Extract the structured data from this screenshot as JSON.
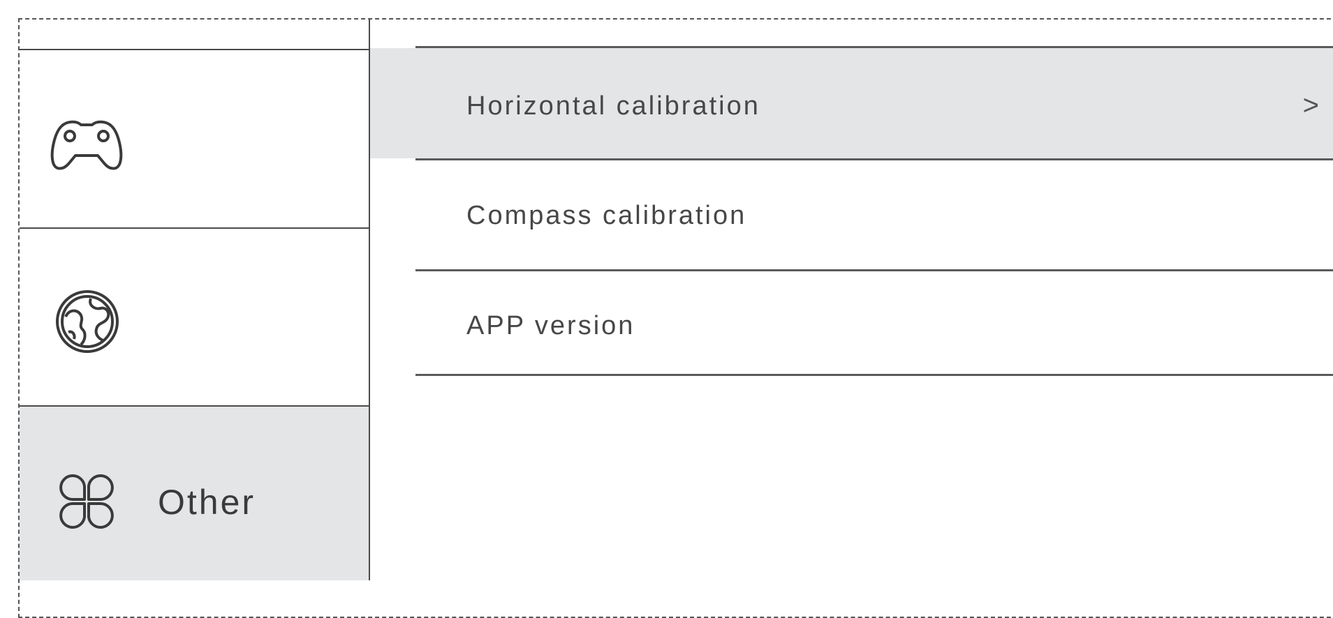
{
  "sidebar": {
    "items": [
      {
        "icon": "gamepad-icon",
        "label": ""
      },
      {
        "icon": "globe-icon",
        "label": ""
      },
      {
        "icon": "clover-grid-icon",
        "label": "Other",
        "selected": true
      }
    ]
  },
  "menu": {
    "items": [
      {
        "label": "Horizontal calibration",
        "chevron": ">",
        "selected": true
      },
      {
        "label": "Compass calibration"
      },
      {
        "label": "APP version"
      }
    ]
  },
  "colors": {
    "selected_bg": "#e4e5e7",
    "line": "#4a4a4a",
    "text": "#474747"
  }
}
